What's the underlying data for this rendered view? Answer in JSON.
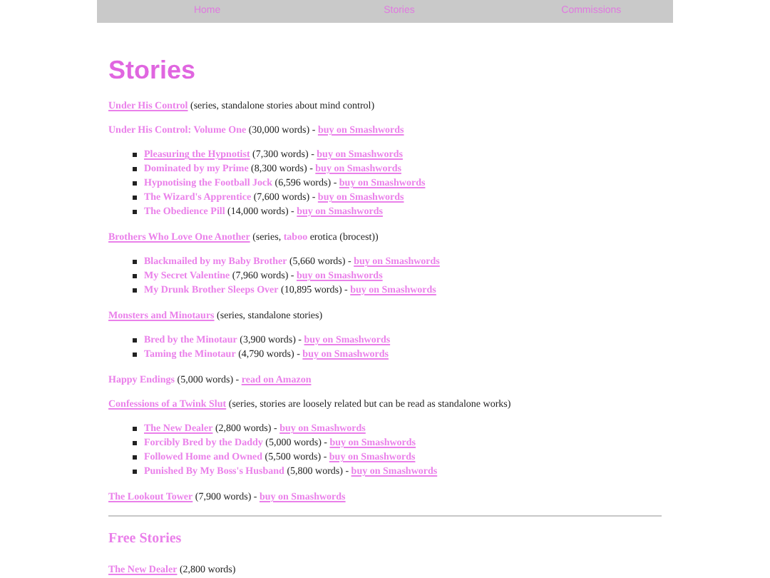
{
  "nav": [
    {
      "label": "Home"
    },
    {
      "label": "Stories"
    },
    {
      "label": "Commissions"
    }
  ],
  "heading": "Stories",
  "entries": [
    {
      "title": "Under His Control",
      "underlined": true,
      "details": [
        {
          "text": "(series, standalone stories about mind control)",
          "highlight": false
        }
      ]
    },
    {
      "title": "Under His Control: Volume One",
      "underlined": false,
      "details": [
        {
          "text": "(30,000 words) -",
          "highlight": false
        }
      ],
      "link": "buy on Smashwords",
      "children": [
        {
          "title": "Pleasuring the Hypnotist",
          "underlined": true,
          "details": [
            {
              "text": "(7,300 words) -",
              "highlight": false
            }
          ],
          "link": "buy on Smashwords"
        },
        {
          "title": "Dominated by my Prime",
          "underlined": false,
          "details": [
            {
              "text": "(8,300 words) -",
              "highlight": false
            }
          ],
          "link": "buy on Smashwords"
        },
        {
          "title": "Hypnotising the Football Jock",
          "underlined": false,
          "details": [
            {
              "text": "(6,596 words) -",
              "highlight": false
            }
          ],
          "link": "buy on Smashwords"
        },
        {
          "title": "The Wizard's Apprentice",
          "underlined": false,
          "details": [
            {
              "text": "(7,600 words) -",
              "highlight": false
            }
          ],
          "link": "buy on Smashwords"
        },
        {
          "title": "The Obedience Pill",
          "underlined": false,
          "details": [
            {
              "text": "(14,000 words) -",
              "highlight": false
            }
          ],
          "link": "buy on Smashwords"
        }
      ]
    },
    {
      "title": "Brothers Who Love One Another",
      "underlined": true,
      "details": [
        {
          "text": "(series,",
          "highlight": false
        },
        {
          "text": "taboo",
          "highlight": true
        },
        {
          "text": "erotica (brocest))",
          "highlight": false
        }
      ],
      "children": [
        {
          "title": "Blackmailed by my Baby Brother",
          "underlined": false,
          "details": [
            {
              "text": "(5,660 words) -",
              "highlight": false
            }
          ],
          "link": "buy on Smashwords"
        },
        {
          "title": "My Secret Valentine",
          "underlined": false,
          "details": [
            {
              "text": "(7,960 words) -",
              "highlight": false
            }
          ],
          "link": "buy on Smashwords"
        },
        {
          "title": "My Drunk Brother Sleeps Over",
          "underlined": false,
          "details": [
            {
              "text": "(10,895 words) -",
              "highlight": false
            }
          ],
          "link": "buy on Smashwords"
        }
      ]
    },
    {
      "title": "Monsters and Minotaurs",
      "underlined": true,
      "details": [
        {
          "text": "(series, standalone stories)",
          "highlight": false
        }
      ],
      "children": [
        {
          "title": "Bred by the Minotaur",
          "underlined": false,
          "details": [
            {
              "text": "(3,900 words) -",
              "highlight": false
            }
          ],
          "link": "buy on Smashwords"
        },
        {
          "title": "Taming the Minotaur",
          "underlined": false,
          "details": [
            {
              "text": "(4,790 words) -",
              "highlight": false
            }
          ],
          "link": "buy on Smashwords"
        }
      ]
    },
    {
      "title": "Happy Endings",
      "underlined": false,
      "details": [
        {
          "text": "(5,000 words) -",
          "highlight": false
        }
      ],
      "link": "read on Amazon"
    },
    {
      "title": "Confessions of a Twink Slut",
      "underlined": true,
      "details": [
        {
          "text": "(series, stories are loosely related but can be read as standalone works)",
          "highlight": false
        }
      ],
      "children": [
        {
          "title": "The New Dealer",
          "underlined": true,
          "details": [
            {
              "text": "(2,800 words) -",
              "highlight": false
            }
          ],
          "link": "buy on Smashwords"
        },
        {
          "title": "Forcibly Bred by the Daddy",
          "underlined": false,
          "details": [
            {
              "text": "(5,000 words) -",
              "highlight": false
            }
          ],
          "link": "buy on Smashwords"
        },
        {
          "title": "Followed Home and Owned",
          "underlined": false,
          "details": [
            {
              "text": "(5,500 words) -",
              "highlight": false
            }
          ],
          "link": "buy on Smashwords"
        },
        {
          "title": "Punished By My Boss's Husband",
          "underlined": false,
          "details": [
            {
              "text": "(5,800 words) -",
              "highlight": false
            }
          ],
          "link": "buy on Smashwords"
        }
      ]
    },
    {
      "title": "The Lookout Tower",
      "underlined": true,
      "details": [
        {
          "text": "(7,900 words) -",
          "highlight": false
        }
      ],
      "link": "buy on Smashwords"
    }
  ],
  "free_heading": "Free Stories",
  "free_entries": [
    {
      "title": "The New Dealer",
      "underlined": true,
      "details": [
        {
          "text": "(2,800 words)",
          "highlight": false
        }
      ]
    }
  ]
}
